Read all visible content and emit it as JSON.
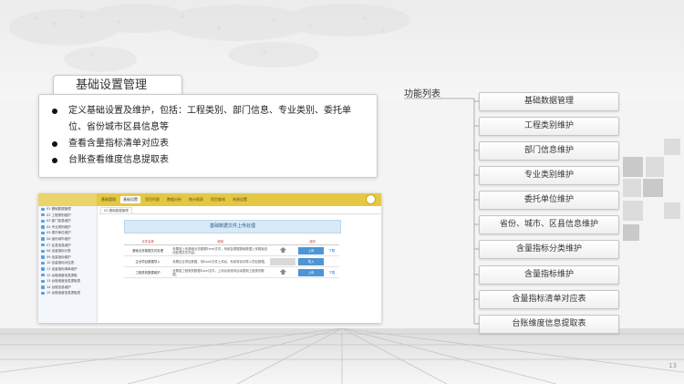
{
  "slide": {
    "title": "基础设置管理",
    "bullets": [
      "定义基础设置及维护，包括：工程类别、部门信息、专业类别、委托单位、省份城市区县信息等",
      "查看含量指标清单对应表",
      "台账查看维度信息提取表"
    ],
    "function_list_label": "功能列表",
    "function_items": [
      "基础数据管理",
      "工程类别维护",
      "部门信息维护",
      "专业类别维护",
      "委托单位维护",
      "省份、城市、区县信息维护",
      "含量指标分类维护",
      "含量指标维护",
      "含量指标清单对应表",
      "台账维度信息提取表"
    ],
    "page_number": "13"
  },
  "mini_app": {
    "menu": [
      "基础管理",
      "基础设置",
      "项目列表",
      "数据分析",
      "统计报表",
      "项目查询",
      "系统设置"
    ],
    "active_menu_index": 1,
    "sidebar": [
      "01 基础数据管理",
      "02 工程类别维护",
      "03 部门信息维护",
      "04 专业类别维护",
      "05 委托单位维护",
      "06 省份城市维护",
      "07 区县信息维护",
      "08 含量指标分类",
      "09 含量指标维护",
      "10 含量指标对应表",
      "11 含量指标清单维护",
      "12 台账维度信息提取",
      "13 台账维度信息提取表",
      "14 台账信息维护",
      "15 台账维度信息提取表"
    ],
    "tab_label": "03-基础数据管理",
    "panel_title": "基础数据文件上传处理",
    "columns": [
      "文件名称",
      "说明",
      "操作"
    ],
    "rows": [
      {
        "name": "基础业务数据文件处理",
        "desc": "设置各上传基础业务数据Excel文件，系统会根据基础数据上传模板自动处理文件内容。",
        "button": "上传",
        "link": "下载"
      },
      {
        "name": "企业项目数据导入",
        "desc": "设置企业项目数据，将Excel文件上传后，系统将自动导入项目数据。",
        "button": "导入",
        "link": ""
      },
      {
        "name": "工程类别数据维护",
        "desc": "设置各工程类别数据Excel文件，上传后系统将自动更新工程类别数据。",
        "button": "上传",
        "link": "下载"
      }
    ]
  }
}
